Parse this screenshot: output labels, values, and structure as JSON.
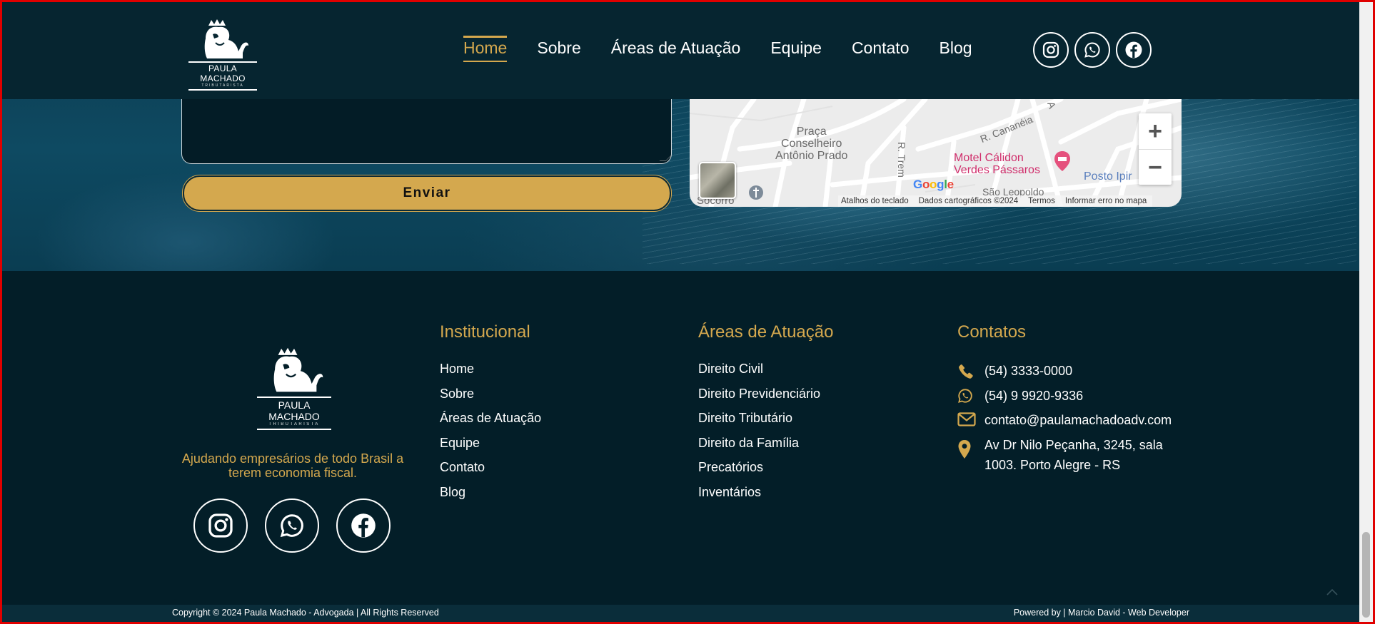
{
  "header": {
    "logo": {
      "name": "PAULA MACHADO",
      "sub": "TRIBUTARISTA"
    },
    "nav": [
      {
        "label": "Home",
        "active": true
      },
      {
        "label": "Sobre"
      },
      {
        "label": "Áreas de Atuação"
      },
      {
        "label": "Equipe"
      },
      {
        "label": "Contato"
      },
      {
        "label": "Blog"
      }
    ],
    "social": [
      "instagram-icon",
      "whatsapp-icon",
      "facebook-icon"
    ]
  },
  "form": {
    "submit_label": "Enviar"
  },
  "map": {
    "labels": {
      "praca": "Praça\nConselheiro\nAntônio Prado",
      "street_caneia": "R. Cananéia",
      "hotel": "Motel Cálidon\nVerdes Pássaros",
      "posto": "Posto Ipir",
      "street_tre": "R. Trem",
      "socorro": "Socorro",
      "sao_leopoldo": "São Leopoldo",
      "street_a": "A"
    },
    "brand": "Google",
    "attribution": [
      "Atalhos do teclado",
      "Dados cartográficos ©2024",
      "Termos",
      "Informar erro no mapa"
    ],
    "zoom_in": "+",
    "zoom_out": "−"
  },
  "footer": {
    "logo": {
      "name": "PAULA MACHADO",
      "sub": "TRIBUTARISTA"
    },
    "tagline": "Ajudando empresários de todo Brasil a terem economia fiscal.",
    "columns": {
      "institucional": {
        "title": "Institucional",
        "items": [
          "Home",
          "Sobre",
          "Áreas de Atuação",
          "Equipe",
          "Contato",
          "Blog"
        ]
      },
      "areas": {
        "title": "Áreas de Atuação",
        "items": [
          "Direito Civil",
          "Direito Previdenciário",
          "Direito Tributário",
          "Direito da Família",
          "Precatórios",
          "Inventários"
        ]
      },
      "contatos": {
        "title": "Contatos",
        "phone": "(54) 3333-0000",
        "whatsapp": "(54) 9 9920-9336",
        "email": "contato@paulamachadoadv.com",
        "address": "Av Dr Nilo Peçanha, 3245, sala 1003. Porto Alegre - RS"
      }
    },
    "copyright": "Copyright © 2024 Paula Machado - Advogada | All Rights Reserved",
    "powered": "Powered by | Marcio David - Web Developer"
  },
  "colors": {
    "accent": "#d4a84e",
    "background": "#031e28",
    "header": "#062530"
  }
}
